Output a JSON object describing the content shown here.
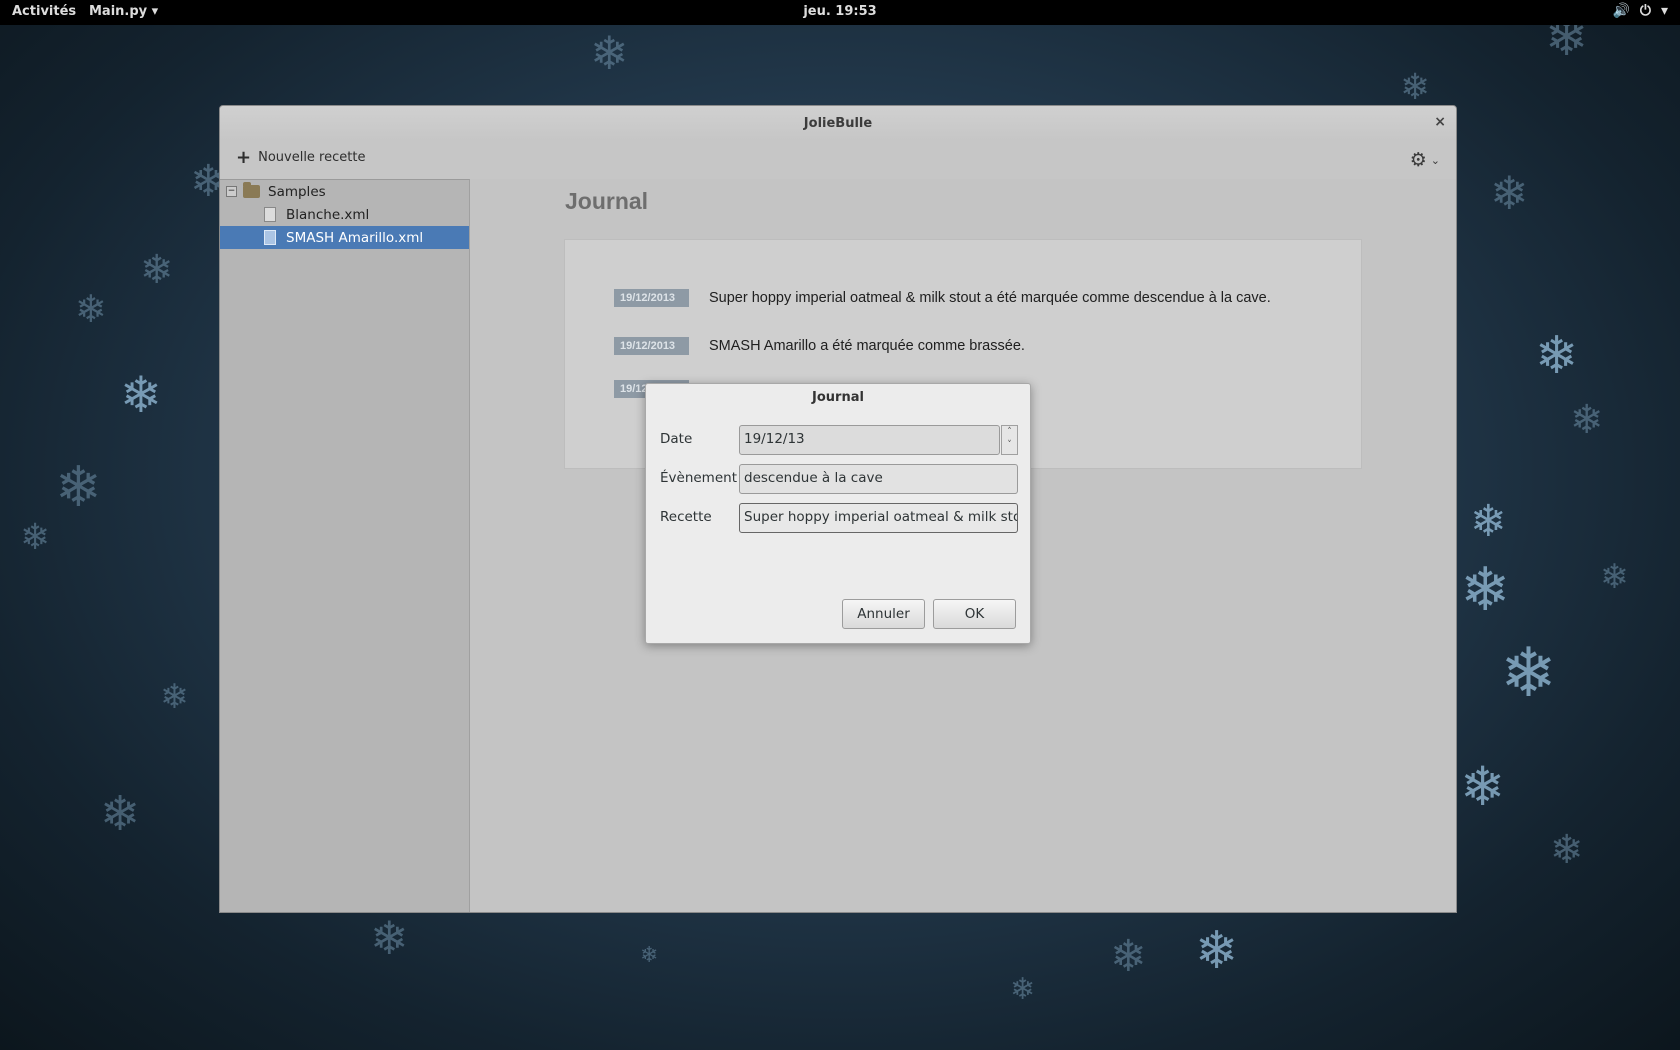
{
  "topbar": {
    "activities": "Activités",
    "app_menu": "Main.py ▾",
    "clock": "jeu. 19:53",
    "volume_icon": "🔊",
    "power_icon": "⏻",
    "power_menu_arrow": "▾"
  },
  "window": {
    "title": "JolieBulle",
    "close": "×",
    "toolbar": {
      "new_recipe_icon": "+",
      "new_recipe_label": "Nouvelle recette",
      "gear_icon": "⚙",
      "gear_chevron": "⌄"
    },
    "sidebar": {
      "folder_toggle": "−",
      "folder": "Samples",
      "files": [
        "Blanche.xml",
        "SMASH Amarillo.xml"
      ]
    },
    "content": {
      "heading": "Journal",
      "entries": [
        {
          "date": "19/12/2013",
          "text": "Super hoppy imperial oatmeal & milk stout a été marquée comme descendue à la cave."
        },
        {
          "date": "19/12/2013",
          "text": "SMASH Amarillo a été marquée comme brassée."
        },
        {
          "date": "19/12/2013",
          "text": ""
        }
      ]
    }
  },
  "dialog": {
    "title": "Journal",
    "date_label": "Date",
    "date_value": "19/12/13",
    "spin_up": "˄",
    "spin_down": "˅",
    "event_label": "Évènement",
    "event_value": "descendue à la cave",
    "recipe_label": "Recette",
    "recipe_value": "Super hoppy imperial oatmeal  & milk stout",
    "cancel": "Annuler",
    "ok": "OK"
  },
  "colors": {
    "selection": "#4a7ab5",
    "date_badge": "#8e9aa5",
    "topbar": "#000000"
  }
}
